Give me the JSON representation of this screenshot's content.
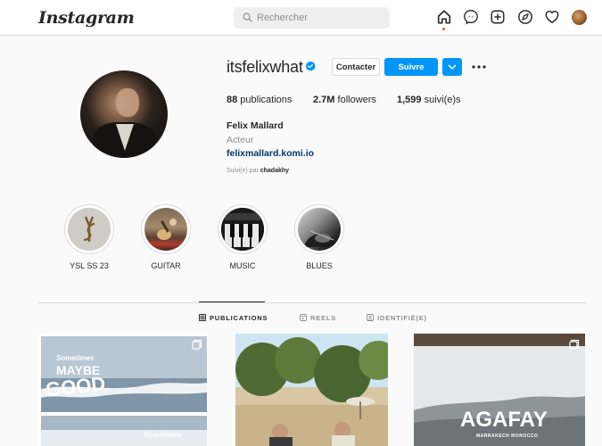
{
  "nav": {
    "logo": "Instagram",
    "search_placeholder": "Rechercher",
    "icons": [
      "home-icon",
      "messenger-icon",
      "new-post-icon",
      "explore-icon",
      "heart-icon",
      "profile-avatar"
    ]
  },
  "profile": {
    "username": "itsfelixwhat",
    "verified": true,
    "contact_label": "Contacter",
    "follow_label": "Suivre",
    "stats": {
      "posts_count": "88",
      "posts_label": " publications",
      "followers_count": "2.7M",
      "followers_label": " followers",
      "following_count": "1,599",
      "following_label": " suivi(e)s"
    },
    "full_name": "Felix Mallard",
    "category": "Acteur",
    "website": "felixmallard.komi.io",
    "followed_by_prefix": "Suivi(e) par ",
    "followed_by_user": "chadakhy"
  },
  "highlights": [
    {
      "label": "YSL SS 23"
    },
    {
      "label": "GUITAR"
    },
    {
      "label": "MUSIC"
    },
    {
      "label": "BLUES"
    }
  ],
  "tabs": [
    {
      "label": "PUBLICATIONS",
      "active": true
    },
    {
      "label": "REELS",
      "active": false
    },
    {
      "label": "IDENTIFIÉ(E)",
      "active": false
    }
  ],
  "posts": [
    {
      "overlay_text_1": "Sometimes",
      "overlay_text_2": "MAYBE",
      "overlay_text_3": "GOOD",
      "overlay_text_4": "Sometimes",
      "type": "carousel"
    },
    {
      "type": "photo"
    },
    {
      "overlay_text": "AGAFAY",
      "overlay_sub": "MARRAKECH MOROCCO",
      "type": "carousel"
    }
  ],
  "colors": {
    "accent": "#0095f6",
    "link": "#00376b",
    "notification_dot": "#ed4956"
  }
}
